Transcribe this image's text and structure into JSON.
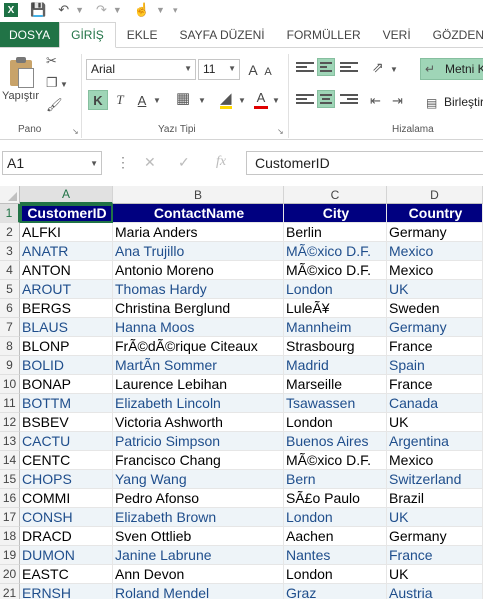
{
  "app": {
    "icon_letter": "X"
  },
  "ribbon": {
    "tabs": [
      {
        "label": "DOSYA",
        "name": "tab-dosya",
        "kind": "file"
      },
      {
        "label": "GİRİŞ",
        "name": "tab-giris",
        "kind": "active"
      },
      {
        "label": "EKLE",
        "name": "tab-ekle",
        "kind": ""
      },
      {
        "label": "SAYFA DÜZENİ",
        "name": "tab-sayfa-duzeni",
        "kind": ""
      },
      {
        "label": "FORMÜLLER",
        "name": "tab-formuller",
        "kind": ""
      },
      {
        "label": "VERİ",
        "name": "tab-veri",
        "kind": ""
      },
      {
        "label": "GÖZDEN",
        "name": "tab-gozden",
        "kind": ""
      }
    ],
    "clipboard": {
      "paste_label": "Yapıştır",
      "group_label": "Pano"
    },
    "font": {
      "name": "Arial",
      "size": "11",
      "bold": "K",
      "italic": "T",
      "underline": "A",
      "grow": "A",
      "shrink": "A",
      "font_color": "A",
      "group_label": "Yazı Tipi"
    },
    "alignment": {
      "wrap_label": "Metni K",
      "merge_label": "Birleştir",
      "group_label": "Hizalama"
    }
  },
  "formula_bar": {
    "name_box": "A1",
    "formula": "CustomerID",
    "fx": "fx",
    "dots": "⋮"
  },
  "grid": {
    "columns": [
      "A",
      "B",
      "C",
      "D"
    ],
    "header": [
      "CustomerID",
      "ContactName",
      "City",
      "Country"
    ],
    "rows": [
      [
        "ALFKI",
        "Maria Anders",
        "Berlin",
        "Germany"
      ],
      [
        "ANATR",
        "Ana Trujillo",
        "MÃ©xico D.F.",
        "Mexico"
      ],
      [
        "ANTON",
        "Antonio Moreno",
        "MÃ©xico D.F.",
        "Mexico"
      ],
      [
        "AROUT",
        "Thomas Hardy",
        "London",
        "UK"
      ],
      [
        "BERGS",
        "Christina Berglund",
        "LuleÃ¥",
        "Sweden"
      ],
      [
        "BLAUS",
        "Hanna Moos",
        "Mannheim",
        "Germany"
      ],
      [
        "BLONP",
        "FrÃ©dÃ©rique Citeaux",
        "Strasbourg",
        "France"
      ],
      [
        "BOLID",
        "MartÃ­n Sommer",
        "Madrid",
        "Spain"
      ],
      [
        "BONAP",
        "Laurence Lebihan",
        "Marseille",
        "France"
      ],
      [
        "BOTTM",
        "Elizabeth Lincoln",
        "Tsawassen",
        "Canada"
      ],
      [
        "BSBEV",
        "Victoria Ashworth",
        "London",
        "UK"
      ],
      [
        "CACTU",
        "Patricio Simpson",
        "Buenos Aires",
        "Argentina"
      ],
      [
        "CENTC",
        "Francisco Chang",
        "MÃ©xico D.F.",
        "Mexico"
      ],
      [
        "CHOPS",
        "Yang Wang",
        "Bern",
        "Switzerland"
      ],
      [
        "COMMI",
        "Pedro Afonso",
        "SÃ£o Paulo",
        "Brazil"
      ],
      [
        "CONSH",
        "Elizabeth Brown",
        "London",
        "UK"
      ],
      [
        "DRACD",
        "Sven Ottlieb",
        "Aachen",
        "Germany"
      ],
      [
        "DUMON",
        "Janine Labrune",
        "Nantes",
        "France"
      ],
      [
        "EASTC",
        "Ann Devon",
        "London",
        "UK"
      ],
      [
        "ERNSH",
        "Roland Mendel",
        "Graz",
        "Austria"
      ]
    ]
  }
}
